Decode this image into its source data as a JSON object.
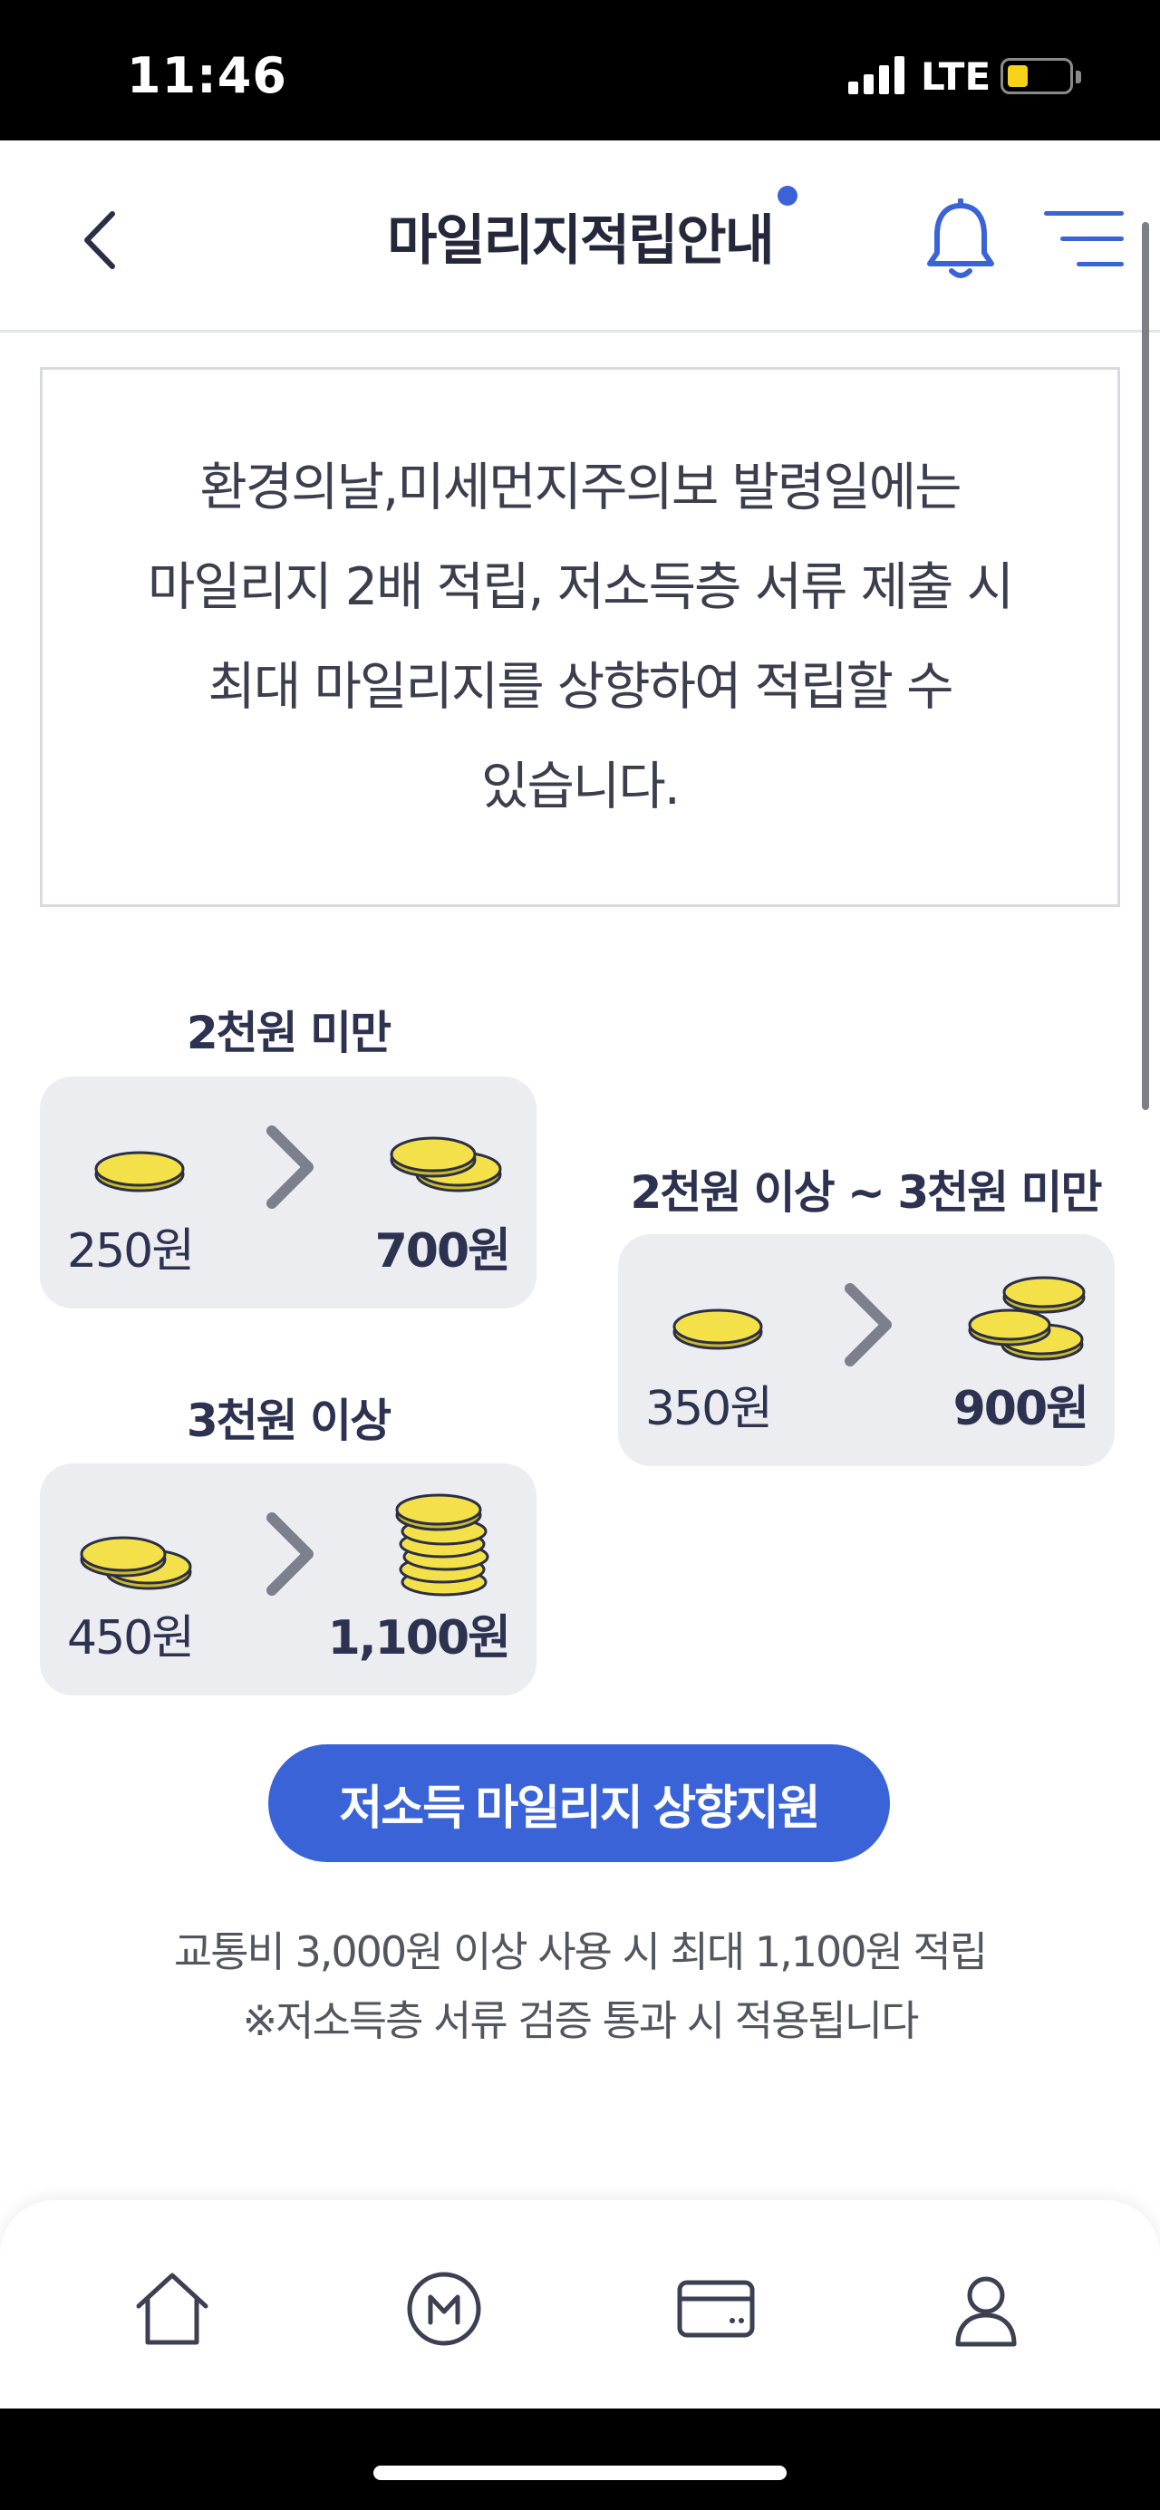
{
  "status_bar": {
    "time": "11:46",
    "network": "LTE"
  },
  "header": {
    "title": "마일리지적립안내"
  },
  "intro": {
    "text": "환경의날,미세먼지주의보 발령일에는\n마일리지 2배 적립, 저소득층 서류 제출 시\n최대 마일리지를 상향하여 적립할 수\n있습니다."
  },
  "tiers": [
    {
      "title": "2천원 미만",
      "from": "250원",
      "to": "700원"
    },
    {
      "title": "2천원 이상 ~ 3천원 미만",
      "from": "350원",
      "to": "900원"
    },
    {
      "title": "3천원 이상",
      "from": "450원",
      "to": "1,100원"
    }
  ],
  "cta": {
    "label": "저소득 마일리지 상향지원"
  },
  "notes": [
    "교통비 3,000원 이상 사용 시 최대 1,100원 적립",
    "※저소득층 서류 검증 통과 시 적용됩니다"
  ],
  "nav": [
    "home-icon",
    "mileage-icon",
    "card-icon",
    "profile-icon"
  ],
  "colors": {
    "accent": "#3a63d8",
    "card_bg": "#ecedf0",
    "coin": "#f4e14a",
    "text_dark": "#2d3250"
  }
}
